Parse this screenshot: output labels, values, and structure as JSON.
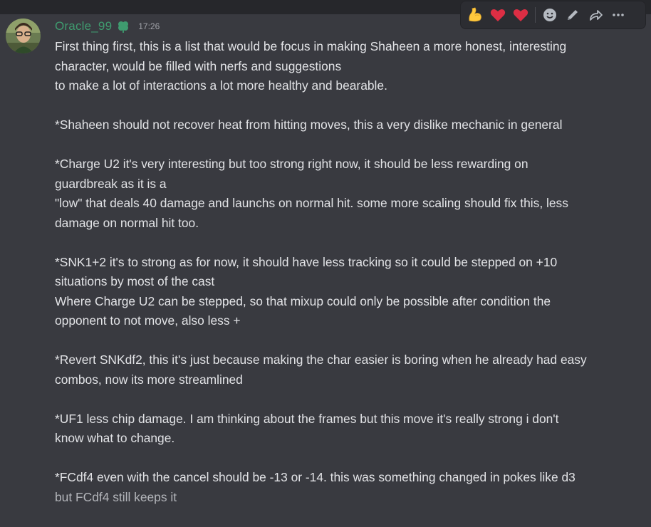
{
  "message": {
    "username": "Oracle_99",
    "timestamp": "17:26",
    "lines": [
      "First thing first, this is a list that would be focus in making Shaheen a more honest, interesting",
      "character, would be filled with nerfs and suggestions",
      "to make a lot of interactions a lot more healthy and bearable.",
      "",
      "*Shaheen should not recover heat from hitting moves, this a very dislike mechanic in general",
      "",
      "*Charge U2 it's very interesting but too strong right now, it should be less rewarding on",
      "guardbreak as it is a",
      "\"low\" that deals 40 damage and launchs on normal hit. some more scaling should fix this, less",
      "damage on normal hit too.",
      "",
      "*SNK1+2 it's to strong as for now, it should have less tracking so it could be stepped on +10",
      "situations by most of the cast",
      "Where Charge U2 can be stepped, so that mixup could only be possible after condition the",
      "opponent to not move, also less +",
      "",
      "*Revert SNKdf2, this it's just because making the char easier is boring when he already had easy",
      "combos, now its more streamlined",
      "",
      "*UF1 less chip damage. I am thinking about the frames but this move it's really strong i don't",
      "know what to change.",
      "",
      "*FCdf4 even with the cancel should be -13 or -14. this was something changed in pokes like d3",
      "but FCdf4 still keeps it"
    ]
  },
  "toolbar": {
    "icons": [
      "flexed-biceps-emoji",
      "red-heart-emoji",
      "red-heart-emoji",
      "add-reaction-icon",
      "edit-pencil-icon",
      "reply-arrow-icon",
      "more-options-icon"
    ]
  },
  "colors": {
    "background": "#393a40",
    "username": "#3f9b6f",
    "text": "#e2e3e6",
    "timestamp": "#a1a3a9",
    "heart": "#dd2e44",
    "toolbar_bg": "#2c2d32"
  }
}
